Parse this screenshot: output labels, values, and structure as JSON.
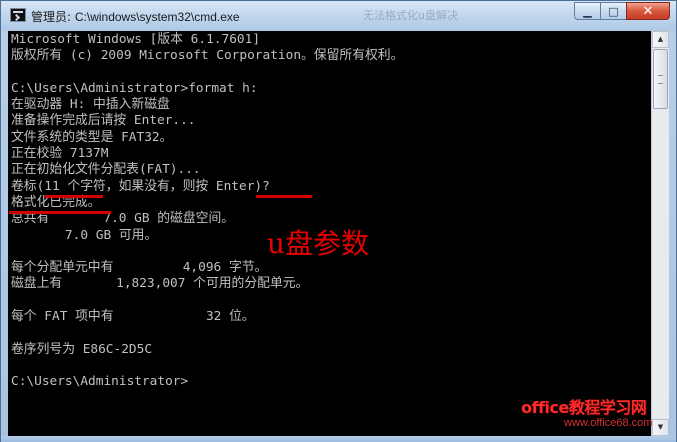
{
  "window": {
    "title_prefix": "管理员: ",
    "title_path": "C:\\windows\\system32\\cmd.exe",
    "background_text": "无法格式化u盘解决",
    "controls": {
      "minimize": "▁",
      "maximize": "□",
      "close": "✕"
    },
    "icons": [
      "cmd-app-icon",
      "minimize-icon",
      "maximize-icon",
      "close-icon"
    ]
  },
  "console": {
    "lines": [
      "Microsoft Windows [版本 6.1.7601]",
      "版权所有 (c) 2009 Microsoft Corporation。保留所有权利。",
      "",
      "C:\\Users\\Administrator>format h:",
      "在驱动器 H: 中插入新磁盘",
      "准备操作完成后请按 Enter...",
      "文件系统的类型是 FAT32。",
      "正在校验 7137M",
      "正在初始化文件分配表(FAT)...",
      "卷标(11 个字符，如果没有，则按 Enter)?",
      "格式化已完成。",
      "总共有       7.0 GB 的磁盘空间。",
      "       7.0 GB 可用。",
      "",
      "每个分配单元中有         4,096 字节。",
      "磁盘上有       1,823,007 个可用的分配单元。",
      "",
      "每个 FAT 项中有            32 位。",
      "",
      "卷序列号为 E86C-2D5C",
      "",
      "C:\\Users\\Administrator>"
    ],
    "colors": {
      "background": "#000000",
      "text": "#c0c0c0"
    }
  },
  "annotation": {
    "text": "u盘参数",
    "color": "#e60000"
  },
  "watermark": {
    "brand": "office教程学习网",
    "url": "www.office68.com"
  }
}
